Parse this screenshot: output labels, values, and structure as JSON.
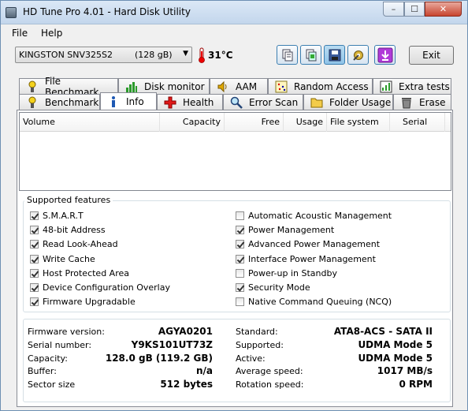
{
  "window": {
    "title": "HD Tune Pro 4.01 - Hard Disk Utility",
    "minimize": "–",
    "maximize": "☐",
    "close": "✕"
  },
  "menu": {
    "file": "File",
    "help": "Help"
  },
  "toolbar": {
    "drive": "KINGSTON SNV325S2        (128 gB)",
    "temperature": "31°C",
    "exit_label": "Exit",
    "buttons": [
      "copy-text-icon",
      "copy-screenshot-icon",
      "save-icon",
      "options-icon",
      "exit-down-icon"
    ]
  },
  "tabs_top": [
    {
      "label": "File Benchmark",
      "icon": "file-benchmark-icon"
    },
    {
      "label": "Disk monitor",
      "icon": "disk-monitor-icon"
    },
    {
      "label": "AAM",
      "icon": "speaker-icon"
    },
    {
      "label": "Random Access",
      "icon": "random-access-icon"
    },
    {
      "label": "Extra tests",
      "icon": "extra-tests-icon"
    }
  ],
  "tabs_bottom": [
    {
      "label": "Benchmark",
      "icon": "benchmark-icon"
    },
    {
      "label": "Info",
      "icon": "info-icon"
    },
    {
      "label": "Health",
      "icon": "health-icon"
    },
    {
      "label": "Error Scan",
      "icon": "error-scan-icon"
    },
    {
      "label": "Folder Usage",
      "icon": "folder-icon"
    },
    {
      "label": "Erase",
      "icon": "erase-icon"
    }
  ],
  "active_tab": "Info",
  "partitions": {
    "columns": [
      "Volume",
      "Capacity",
      "Free",
      "Usage",
      "File system",
      "Serial"
    ]
  },
  "features": {
    "title": "Supported features",
    "left": [
      {
        "label": "S.M.A.R.T",
        "checked": true
      },
      {
        "label": "48-bit Address",
        "checked": true
      },
      {
        "label": "Read Look-Ahead",
        "checked": true
      },
      {
        "label": "Write Cache",
        "checked": true
      },
      {
        "label": "Host Protected Area",
        "checked": true
      },
      {
        "label": "Device Configuration Overlay",
        "checked": true
      },
      {
        "label": "Firmware Upgradable",
        "checked": true
      }
    ],
    "right": [
      {
        "label": "Automatic Acoustic Management",
        "checked": false
      },
      {
        "label": "Power Management",
        "checked": true
      },
      {
        "label": "Advanced Power Management",
        "checked": true
      },
      {
        "label": "Interface Power Management",
        "checked": true
      },
      {
        "label": "Power-up in Standby",
        "checked": false
      },
      {
        "label": "Security Mode",
        "checked": true
      },
      {
        "label": "Native Command Queuing (NCQ)",
        "checked": false
      }
    ]
  },
  "details": {
    "left": [
      {
        "label": "Firmware version:",
        "value": "AGYA0201"
      },
      {
        "label": "Serial number:",
        "value": "Y9KS101UT73Z"
      },
      {
        "label": "Capacity:",
        "value": "128.0 gB (119.2 GB)"
      },
      {
        "label": "Buffer:",
        "value": "n/a"
      },
      {
        "label": "Sector size",
        "value": "512 bytes"
      }
    ],
    "right": [
      {
        "label": "Standard:",
        "value": "ATA8-ACS - SATA II"
      },
      {
        "label": "Supported:",
        "value": "UDMA Mode 5"
      },
      {
        "label": "Active:",
        "value": "UDMA Mode 5"
      },
      {
        "label": "Average speed:",
        "value": "1017 MB/s"
      },
      {
        "label": "Rotation speed:",
        "value": "0 RPM"
      }
    ]
  }
}
